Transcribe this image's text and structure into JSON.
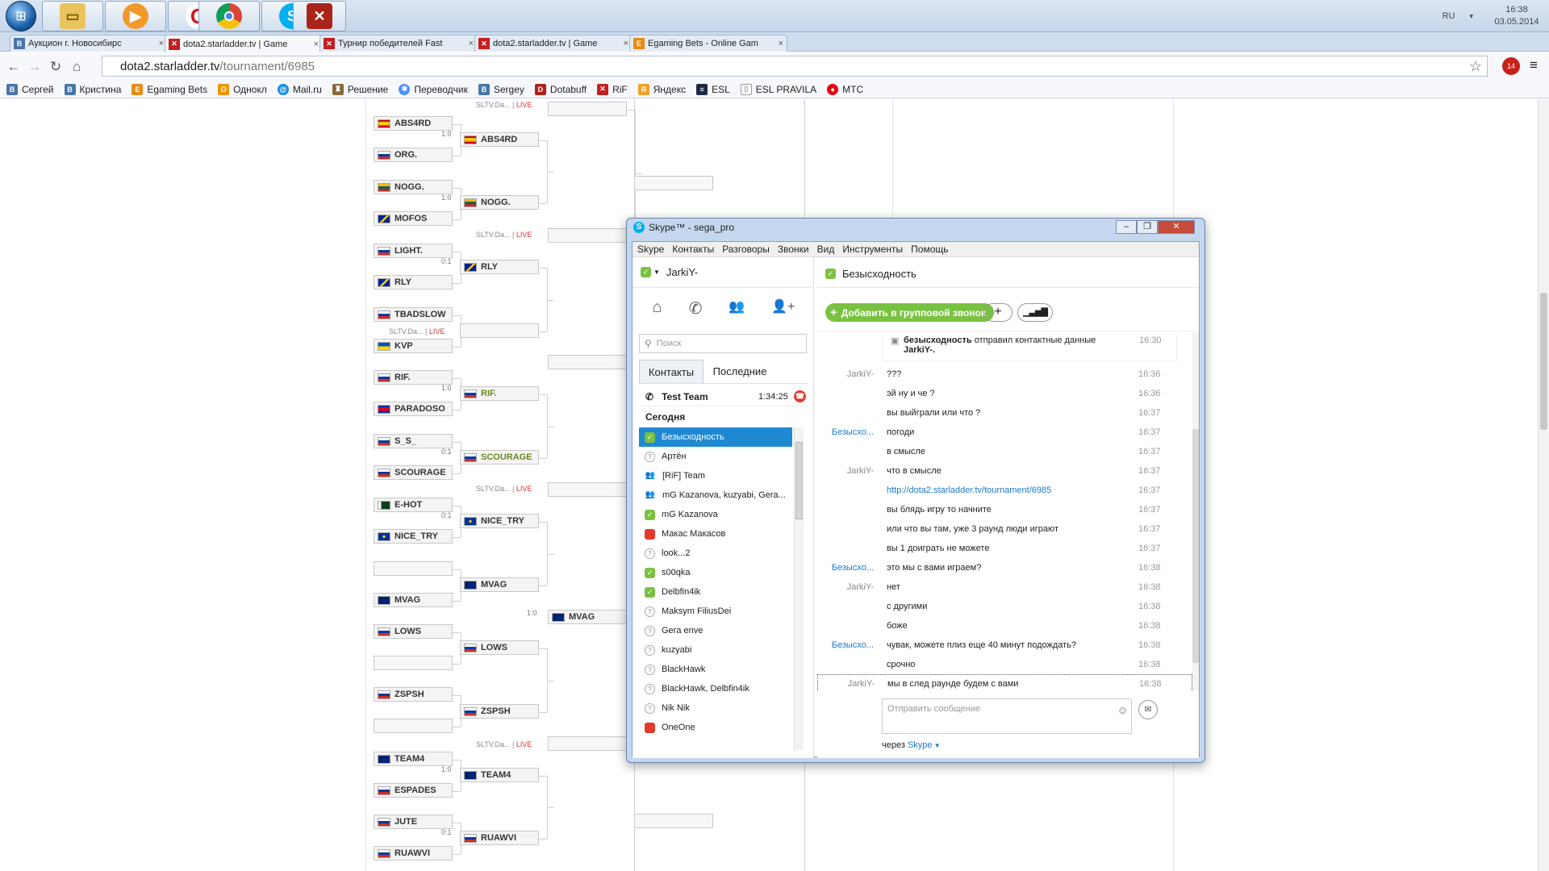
{
  "taskbar": {
    "apps": [
      "file-explorer",
      "media-player",
      "opera",
      "chrome",
      "skype",
      "dota2"
    ],
    "lang": "RU",
    "time": "16:38",
    "date": "03.05.2014"
  },
  "browser": {
    "tabs": [
      {
        "title": "Аукцион г. Новосибирс"
      },
      {
        "title": "dota2.starladder.tv | Game"
      },
      {
        "title": "Турнир победителей Fast"
      },
      {
        "title": "dota2.starladder.tv | Game"
      },
      {
        "title": "Egaming Bets - Online Gam"
      }
    ],
    "url_host": "dota2.starladder.tv",
    "url_path": "/tournament/6985",
    "adblock_count": "14",
    "bookmarks": [
      "Сергей",
      "Кристина",
      "Egaming Bets",
      "Однокл",
      "Mail.ru",
      "Решение",
      "Переводчик",
      "Sergey",
      "Dotabuff",
      "RiF",
      "Яндекс",
      "ESL",
      "ESL PRAVILA",
      "МТС"
    ]
  },
  "bracket": {
    "round1": [
      {
        "name": "ABS4RD",
        "flag": "es"
      },
      {
        "name": "ORG.",
        "flag": "ru"
      },
      {
        "name": "NOGG.",
        "flag": "lt"
      },
      {
        "name": "MOFOS",
        "flag": "ba"
      },
      {
        "name": "LIGHT.",
        "flag": "ru"
      },
      {
        "name": "RLY",
        "flag": "ba"
      },
      {
        "name": "TBADSLOW",
        "flag": "ru"
      },
      {
        "name": "KVP",
        "flag": "ua"
      },
      {
        "name": "RIF.",
        "flag": "ru"
      },
      {
        "name": "PARADOSO",
        "flag": "kh"
      },
      {
        "name": "S_S_",
        "flag": "ru"
      },
      {
        "name": "SCOURAGE",
        "flag": "ru"
      },
      {
        "name": "E-HOT",
        "flag": "pk"
      },
      {
        "name": "NICE_TRY",
        "flag": "eu"
      },
      {
        "name": "",
        "flag": ""
      },
      {
        "name": "MVAG",
        "flag": "au"
      },
      {
        "name": "LOWS",
        "flag": "ru"
      },
      {
        "name": "",
        "flag": ""
      },
      {
        "name": "ZSPSH",
        "flag": "ru"
      },
      {
        "name": "",
        "flag": ""
      },
      {
        "name": "TEAM4",
        "flag": "au"
      },
      {
        "name": "ESPADES",
        "flag": "ru"
      },
      {
        "name": "JUTE",
        "flag": "ru"
      },
      {
        "name": "RUAWVI",
        "flag": "ru"
      }
    ],
    "round1_scores": [
      "1:0",
      "1:0",
      "0:1",
      "",
      "1:0",
      "0:1",
      "0:1",
      "",
      "",
      "",
      "1:0",
      "0:1"
    ],
    "round2": [
      {
        "name": "ABS4RD",
        "flag": "es",
        "green": false
      },
      {
        "name": "NOGG.",
        "flag": "lt",
        "green": false
      },
      {
        "name": "RLY",
        "flag": "ba",
        "green": false
      },
      {
        "name": "",
        "flag": "",
        "green": false
      },
      {
        "name": "RIF.",
        "flag": "ru",
        "green": true
      },
      {
        "name": "SCOURAGE",
        "flag": "ru",
        "green": true
      },
      {
        "name": "NICE_TRY",
        "flag": "eu",
        "green": false
      },
      {
        "name": "MVAG",
        "flag": "au",
        "green": false
      },
      {
        "name": "LOWS",
        "flag": "ru",
        "green": false
      },
      {
        "name": "ZSPSH",
        "flag": "ru",
        "green": false
      },
      {
        "name": "TEAM4",
        "flag": "au",
        "green": false
      },
      {
        "name": "RUAWVI",
        "flag": "ru",
        "green": false
      }
    ],
    "round3": [
      {
        "name": "",
        "flag": ""
      },
      {
        "name": "",
        "flag": ""
      },
      {
        "name": "",
        "flag": ""
      },
      {
        "name": "",
        "flag": ""
      },
      {
        "name": "MVAG",
        "flag": "au"
      },
      {
        "name": "",
        "flag": ""
      }
    ],
    "round3_score": "1:0",
    "live_label": "SLTV.Da...",
    "live_word": "LIVE"
  },
  "skype": {
    "title": "Skype™ - sega_pro",
    "menu": [
      "Skype",
      "Контакты",
      "Разговоры",
      "Звонки",
      "Вид",
      "Инструменты",
      "Помощь"
    ],
    "user": "JarkiY-",
    "search_placeholder": "Поиск",
    "tab_contacts": "Контакты",
    "tab_recent": "Последние",
    "active_call": {
      "name": "Test Team",
      "duration": "1:34:25"
    },
    "section_today": "Сегодня",
    "contacts": [
      {
        "name": "Безысходность",
        "status": "online",
        "selected": true
      },
      {
        "name": "Артён",
        "status": "offline"
      },
      {
        "name": "[RiF] Team",
        "status": "group"
      },
      {
        "name": "mG Kazanova, kuzyabi, Gera...",
        "status": "group"
      },
      {
        "name": "mG Kazanova",
        "status": "online"
      },
      {
        "name": "Макас Макасов",
        "status": "busy"
      },
      {
        "name": "look...2",
        "status": "offline"
      },
      {
        "name": "s00qka",
        "status": "online"
      },
      {
        "name": "Delbfin4ik",
        "status": "online"
      },
      {
        "name": "Maksym FiliusDei",
        "status": "offline"
      },
      {
        "name": "Gera enve",
        "status": "offline"
      },
      {
        "name": "kuzyabi",
        "status": "offline"
      },
      {
        "name": "BlackHawk",
        "status": "offline"
      },
      {
        "name": "BlackHawk, Delbfin4ik",
        "status": "offline"
      },
      {
        "name": "Nik Nik",
        "status": "offline"
      },
      {
        "name": "OneOne",
        "status": "busy"
      }
    ],
    "chat_title": "Безысходность",
    "add_group_call": "Добавить в групповой звонок",
    "system_msg": {
      "bold": "безысходность",
      "text": " отправил контактные данные ",
      "bold2": "JarkiY-.",
      "time": "16:30"
    },
    "messages": [
      {
        "author": "JarkiY-",
        "blue": false,
        "text": "???",
        "time": "16:36"
      },
      {
        "author": "",
        "blue": false,
        "text": "эй ну и че ?",
        "time": "16:36"
      },
      {
        "author": "",
        "blue": false,
        "text": "вы выйграли или что ?",
        "time": "16:37"
      },
      {
        "author": "Безысхо...",
        "blue": true,
        "text": "погоди",
        "time": "16:37"
      },
      {
        "author": "",
        "blue": false,
        "text": "в смысле",
        "time": "16:37"
      },
      {
        "author": "JarkiY-",
        "blue": false,
        "text": "что в смысле",
        "time": "16:37"
      },
      {
        "author": "",
        "blue": false,
        "text": "http://dota2.starladder.tv/tournament/6985",
        "time": "16:37",
        "link": true
      },
      {
        "author": "",
        "blue": false,
        "text": "вы блядь игру то начните",
        "time": "16:37"
      },
      {
        "author": "",
        "blue": false,
        "text": "или что вы там, уже 3 раунд люди играют",
        "time": "16:37"
      },
      {
        "author": "",
        "blue": false,
        "text": "вы 1 доиграть не можете",
        "time": "16:37"
      },
      {
        "author": "Безысхо...",
        "blue": true,
        "text": "это мы с вами играем?",
        "time": "16:38"
      },
      {
        "author": "JarkiY-",
        "blue": false,
        "text": "нет",
        "time": "16:38"
      },
      {
        "author": "",
        "blue": false,
        "text": "с другими",
        "time": "16:38"
      },
      {
        "author": "",
        "blue": false,
        "text": "боже",
        "time": "16:38"
      },
      {
        "author": "Безысхо...",
        "blue": true,
        "text": "чувак, можете плиз еще 40 минут подождать?",
        "time": "16:38"
      },
      {
        "author": "",
        "blue": false,
        "text": "срочно",
        "time": "16:38"
      },
      {
        "author": "JarkiY-",
        "blue": false,
        "text": "мы в след раунде будем с вами",
        "time": "16:38"
      }
    ],
    "compose_placeholder": "Отправить сообщение",
    "via_prefix": "через",
    "via_service": "Skype"
  },
  "colors": {
    "skype_blue": "#00aff0",
    "call_green": "#7ac142",
    "selection": "#1f8ad2",
    "live_red": "#dd3333"
  }
}
